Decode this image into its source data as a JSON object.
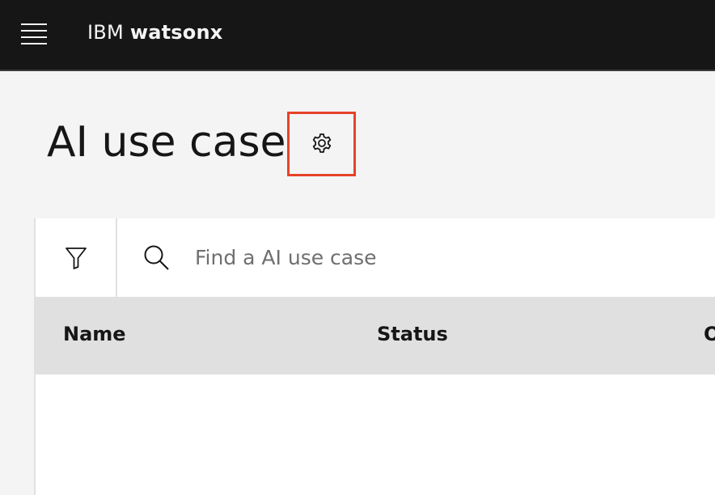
{
  "header": {
    "brand_prefix": "IBM",
    "brand_product": "watsonx",
    "menu_icon": "hamburger-menu-icon"
  },
  "page": {
    "title": "AI use case",
    "settings_icon": "gear-icon"
  },
  "toolbar": {
    "filter_icon": "filter-icon",
    "search_icon": "search-icon",
    "search_placeholder": "Find a AI use case"
  },
  "table": {
    "columns": [
      "Name",
      "Status",
      "O"
    ],
    "rows": []
  },
  "colors": {
    "topbar": "#161616",
    "highlight_border": "#e5432a",
    "page_bg": "#f4f4f4",
    "table_header_bg": "#e0e0e0"
  }
}
